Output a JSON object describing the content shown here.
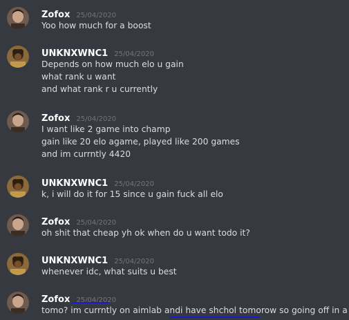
{
  "messages": [
    {
      "author": "Zofox",
      "timestamp": "25/04/2020",
      "avatar_icon": "zofox-avatar",
      "lines": [
        "Yoo how much for a boost"
      ]
    },
    {
      "author": "UNKNXWNC1",
      "timestamp": "25/04/2020",
      "avatar_icon": "unknxwnc1-avatar",
      "lines": [
        "Depends on how much elo u gain",
        "what rank u want",
        "and what rank r u currently"
      ]
    },
    {
      "author": "Zofox",
      "timestamp": "25/04/2020",
      "avatar_icon": "zofox-avatar",
      "lines": [
        "I want like 2 game into champ",
        "gain like 20 elo agame, played like 200 games",
        "and im currntly 4420"
      ]
    },
    {
      "author": "UNKNXWNC1",
      "timestamp": "25/04/2020",
      "avatar_icon": "unknxwnc1-avatar",
      "lines": [
        "k, i will do it for 15 since u gain fuck all elo"
      ]
    },
    {
      "author": "Zofox",
      "timestamp": "25/04/2020",
      "avatar_icon": "zofox-avatar",
      "lines": [
        "oh shit that cheap yh ok when do u want todo it?"
      ]
    },
    {
      "author": "UNKNXWNC1",
      "timestamp": "25/04/2020",
      "avatar_icon": "unknxwnc1-avatar",
      "lines": [
        "whenever idc, what suits u best"
      ]
    },
    {
      "author": "Zofox",
      "timestamp": "25/04/2020",
      "avatar_icon": "zofox-avatar",
      "lines": [
        "tomo? im currntly on aimlab andi have shchol tomorow so going off in a min"
      ]
    }
  ],
  "colors": {
    "background": "#36393f",
    "username": "#ffffff",
    "timestamp": "#72767d",
    "message_text": "#dcddde",
    "annotation_underline": "#1a1bd1"
  }
}
